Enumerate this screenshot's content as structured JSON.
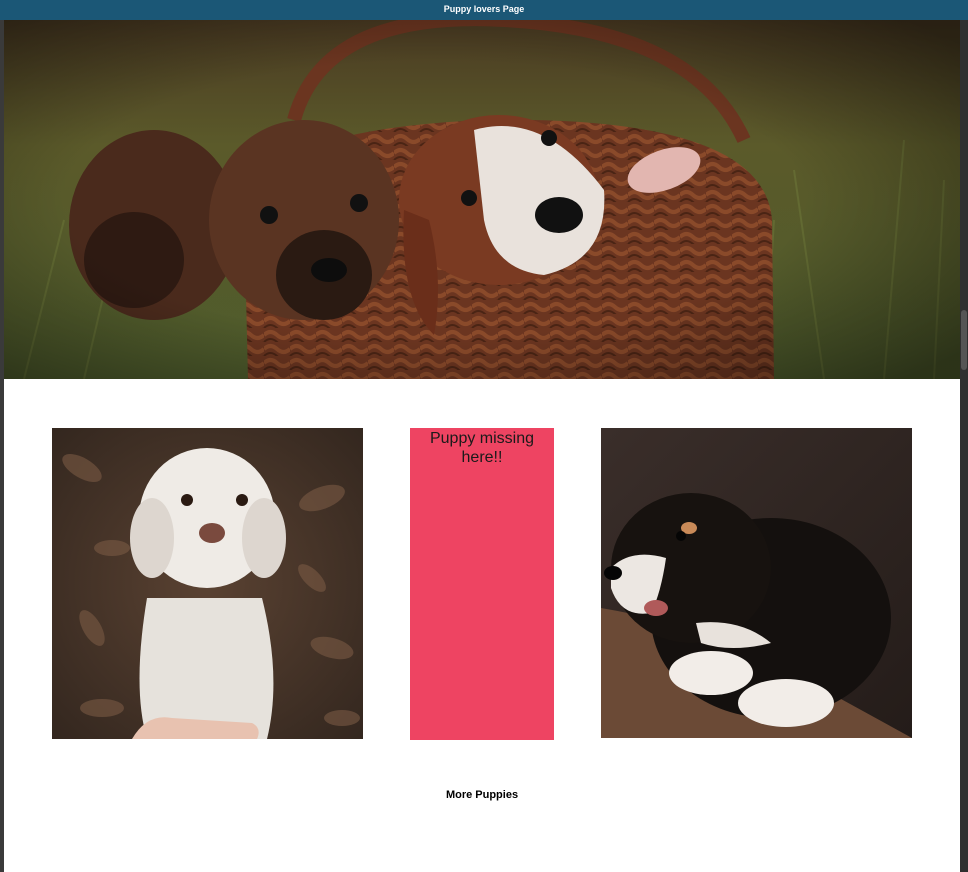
{
  "header": {
    "title": "Puppy lovers Page",
    "color": "#1b5776"
  },
  "hero": {
    "image": "puppies-in-basket-photo"
  },
  "gallery": {
    "left_image": "white-curly-puppy-photo",
    "missing_card": {
      "text": "Puppy missing here!!",
      "color": "#ee4462"
    },
    "right_image": "black-puppy-photo"
  },
  "more_button": {
    "label": "More Puppies"
  }
}
